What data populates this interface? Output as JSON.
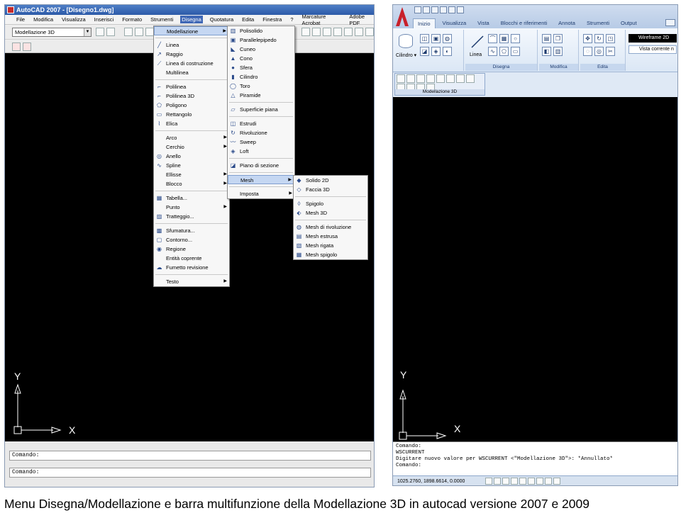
{
  "left": {
    "window_title": "AutoCAD 2007 - [Disegno1.dwg]",
    "menubar": [
      "File",
      "Modifica",
      "Visualizza",
      "Inserisci",
      "Formato",
      "Strumenti",
      "Disegna",
      "Quotatura",
      "Edita",
      "Finestra",
      "?",
      "Marcature Acrobat",
      "Adobe PDF"
    ],
    "active_menu_index": 6,
    "workspace": "Modellazione 3D",
    "disegna_menu": [
      {
        "label": "Modellazione",
        "icon": "",
        "submenu": true,
        "selected": true
      },
      {
        "sep": true
      },
      {
        "label": "Linea",
        "icon": "line-icon"
      },
      {
        "label": "Raggio",
        "icon": "ray-icon"
      },
      {
        "label": "Linea di costruzione",
        "icon": "xline-icon"
      },
      {
        "label": "Multilinea",
        "icon": ""
      },
      {
        "sep": true
      },
      {
        "label": "Polilinea",
        "icon": "polyline-icon"
      },
      {
        "label": "Polilinea 3D",
        "icon": "polyline3d-icon"
      },
      {
        "label": "Poligono",
        "icon": "polygon-icon"
      },
      {
        "label": "Rettangolo",
        "icon": "rectangle-icon"
      },
      {
        "label": "Elica",
        "icon": "helix-icon"
      },
      {
        "sep": true
      },
      {
        "label": "Arco",
        "icon": "",
        "submenu": true
      },
      {
        "label": "Cerchio",
        "icon": "",
        "submenu": true
      },
      {
        "label": "Anello",
        "icon": "donut-icon"
      },
      {
        "label": "Spline",
        "icon": "spline-icon"
      },
      {
        "label": "Ellisse",
        "icon": "",
        "submenu": true
      },
      {
        "label": "Blocco",
        "icon": "",
        "submenu": true
      },
      {
        "sep": true
      },
      {
        "label": "Tabella...",
        "icon": "table-icon"
      },
      {
        "label": "Punto",
        "icon": "",
        "submenu": true
      },
      {
        "label": "Tratteggio...",
        "icon": "hatch-icon"
      },
      {
        "sep": true
      },
      {
        "label": "Sfumatura...",
        "icon": "gradient-icon"
      },
      {
        "label": "Contorno...",
        "icon": "boundary-icon"
      },
      {
        "label": "Regione",
        "icon": "region-icon"
      },
      {
        "label": "Entità coprente",
        "icon": ""
      },
      {
        "label": "Fumetto revisione",
        "icon": "revcloud-icon"
      },
      {
        "sep": true
      },
      {
        "label": "Testo",
        "icon": "",
        "submenu": true
      }
    ],
    "modellazione_menu": [
      {
        "label": "Polisolido",
        "icon": "polysolid-icon"
      },
      {
        "label": "Parallelepipedo",
        "icon": "box-icon"
      },
      {
        "label": "Cuneo",
        "icon": "wedge-icon"
      },
      {
        "label": "Cono",
        "icon": "cone-icon"
      },
      {
        "label": "Sfera",
        "icon": "sphere-icon"
      },
      {
        "label": "Cilindro",
        "icon": "cylinder-icon"
      },
      {
        "label": "Toro",
        "icon": "torus-icon"
      },
      {
        "label": "Piramide",
        "icon": "pyramid-icon"
      },
      {
        "sep": true
      },
      {
        "label": "Superficie piana",
        "icon": "planesurf-icon"
      },
      {
        "sep": true
      },
      {
        "label": "Estrudi",
        "icon": "extrude-icon"
      },
      {
        "label": "Rivoluzione",
        "icon": "revolve-icon"
      },
      {
        "label": "Sweep",
        "icon": "sweep-icon"
      },
      {
        "label": "Loft",
        "icon": "loft-icon"
      },
      {
        "sep": true
      },
      {
        "label": "Piano di sezione",
        "icon": "sectionplane-icon"
      },
      {
        "sep": true
      },
      {
        "label": "Mesh",
        "icon": "",
        "submenu": true,
        "selected": true
      },
      {
        "sep": true
      },
      {
        "label": "Imposta",
        "icon": "",
        "submenu": true
      }
    ],
    "mesh_menu": [
      {
        "label": "Solido 2D",
        "icon": "solid2d-icon"
      },
      {
        "label": "Faccia 3D",
        "icon": "face3d-icon"
      },
      {
        "sep": true
      },
      {
        "label": "Spigolo",
        "icon": "edge-icon"
      },
      {
        "label": "Mesh 3D",
        "icon": "mesh3d-icon"
      },
      {
        "sep": true
      },
      {
        "label": "Mesh di rivoluzione",
        "icon": "revsurf-icon"
      },
      {
        "label": "Mesh estrusa",
        "icon": "tabsurf-icon"
      },
      {
        "label": "Mesh rigata",
        "icon": "rulesurf-icon"
      },
      {
        "label": "Mesh spigolo",
        "icon": "edgesurf-icon"
      }
    ],
    "axis_y": "Y",
    "axis_x": "X",
    "command_lines": [
      "Comando:",
      "Comando:"
    ]
  },
  "right": {
    "tabs": [
      "Inizio",
      "Visualizza",
      "Vista",
      "Blocchi e riferimenti",
      "Annota",
      "Strumenti",
      "Output"
    ],
    "active_tab_index": 0,
    "panel_labels": [
      "Disegna",
      "Modifica",
      "Edita"
    ],
    "cilindro_label": "Cilindro",
    "linea_label": "Linea",
    "visual_style": "Wireframe 2D",
    "view_label": "Vista corrente n",
    "modellazione3d_label": "Modellazione 3D",
    "axis_y": "Y",
    "axis_x": "X",
    "command_text": [
      "Comando:",
      "WSCURRENT",
      "Digitare nuovo valore per WSCURRENT <\"Modellazione 3D\">: *Annullato*",
      "Comando:"
    ],
    "coordinates": "1025.2760, 1898.6614, 0.0000"
  },
  "caption": "Menu Disegna/Modellazione e barra multifunzione della Modellazione 3D in autocad versione 2007 e 2009",
  "colors": {
    "canvas": "#000000",
    "menu_highlight": "#c5d7f2",
    "title_blue": "#2c5aa8"
  }
}
